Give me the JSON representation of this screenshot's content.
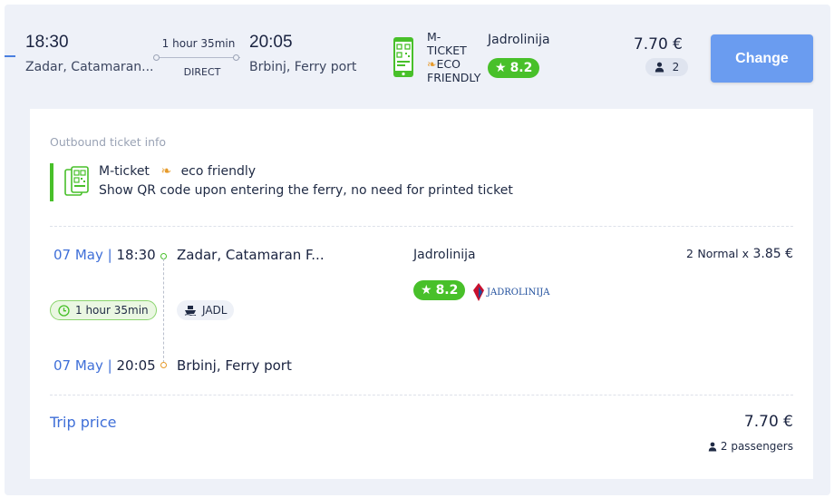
{
  "summary": {
    "departure_time": "18:30",
    "departure_place": "Zadar, Catamaran...",
    "duration": "1 hour 35min",
    "direct_label": "DIRECT",
    "arrival_time": "20:05",
    "arrival_place": "Brbinj, Ferry port",
    "mticket_line1": "M-",
    "mticket_line2": "TICKET",
    "eco_line": "ECO",
    "friendly_line": "FRIENDLY",
    "operator": "Jadrolinija",
    "rating": "8.2",
    "price": "7.70 €",
    "passengers": "2",
    "change_label": "Change"
  },
  "details": {
    "section_label": "Outbound ticket info",
    "mticket_label": "M-ticket",
    "eco_label": "eco friendly",
    "mticket_note": "Show QR code upon entering the ferry, no need for printed ticket",
    "segment": {
      "dep_date": "07 May",
      "dep_time": "18:30",
      "dep_place": "Zadar, Catamaran F...",
      "arr_date": "07 May",
      "arr_time": "20:05",
      "arr_place": "Brbinj, Ferry port",
      "separator": "|",
      "duration": "1 hour 35min",
      "vessel_code": "JADL",
      "operator": "Jadrolinija",
      "rating": "8.2",
      "logo_text": "JADROLINIJA",
      "fare_count": "2",
      "fare_type": "Normal x",
      "fare_price": "3.85 €"
    },
    "trip_price_label": "Trip price",
    "trip_price": "7.70 €",
    "trip_passengers": "2 passengers"
  },
  "colors": {
    "accent_blue": "#3f6fd8",
    "button_blue": "#6a9cf0",
    "rating_green": "#48c02a",
    "eco_orange": "#e69a2a"
  }
}
